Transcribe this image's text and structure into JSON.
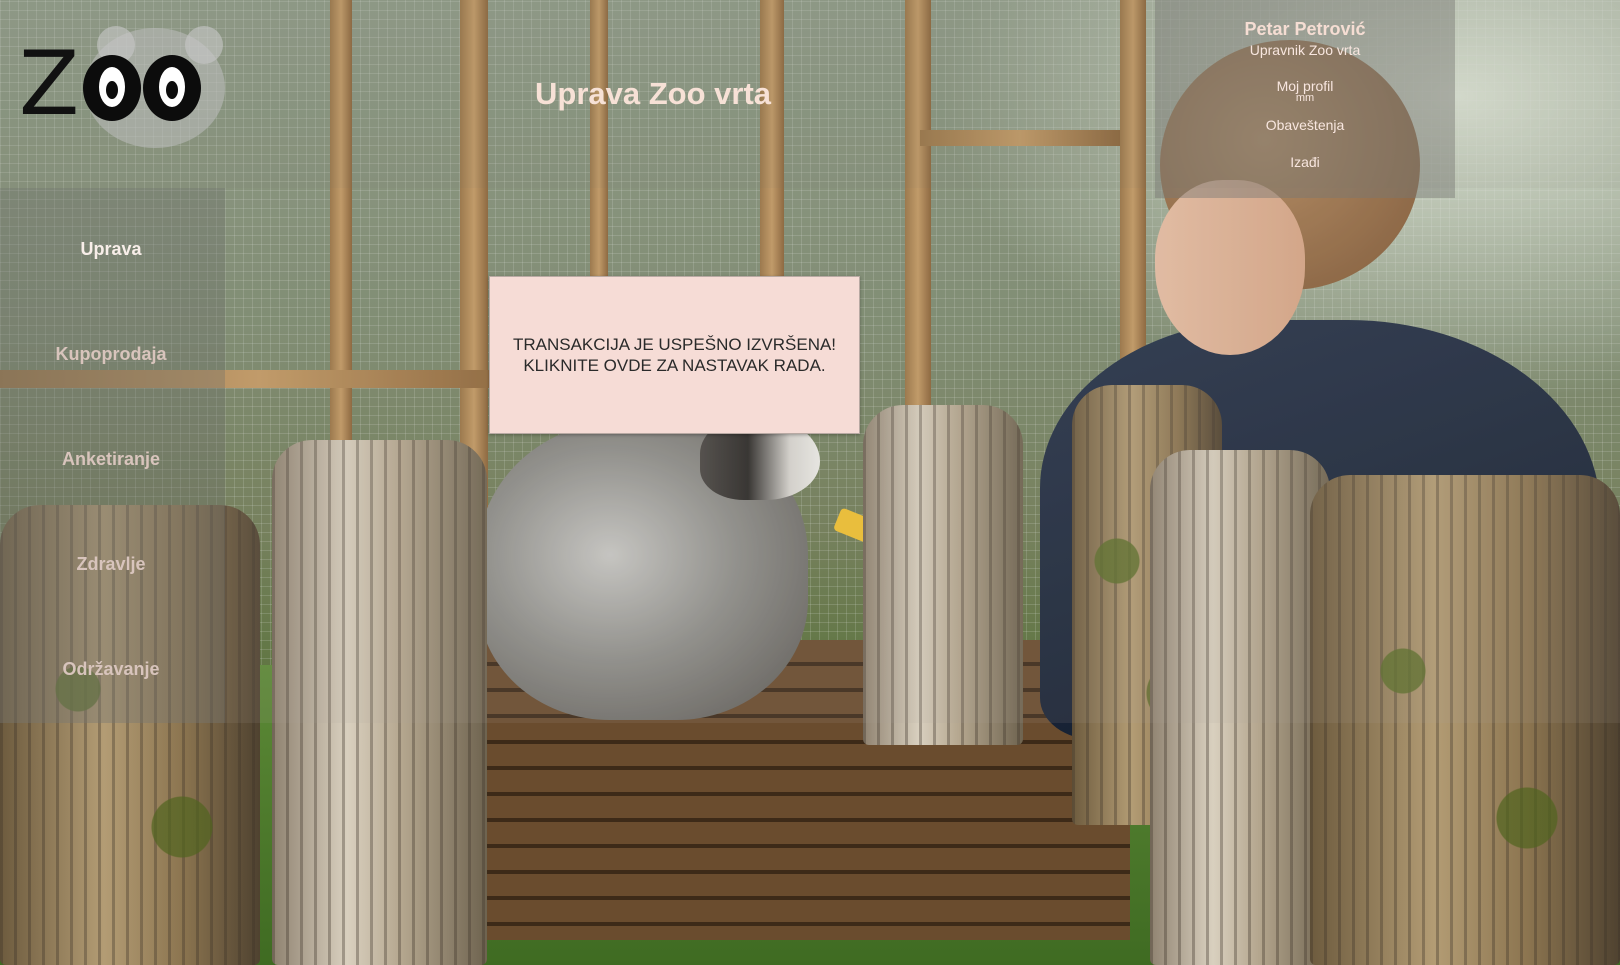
{
  "header": {
    "title": "Uprava Zoo vrta",
    "logo_text": "ZOO"
  },
  "user": {
    "name": "Petar Petrović",
    "role": "Upravnik Zoo vrta",
    "profile_label": "Moj profil",
    "profile_sub": "mm",
    "notifications_label": "Obaveštenja",
    "logout_label": "Izađi"
  },
  "sidebar": {
    "items": [
      {
        "label": "Uprava",
        "active": true
      },
      {
        "label": "Kupoprodaja",
        "active": false
      },
      {
        "label": "Anketiranje",
        "active": false
      },
      {
        "label": "Zdravlje",
        "active": false
      },
      {
        "label": "Održavanje",
        "active": false
      }
    ]
  },
  "modal": {
    "line1": "TRANSAKCIJA JE USPEŠNO IZVRŠENA!",
    "line2": "KLIKNITE OVDE ZA NASTAVAK RADA."
  },
  "colors": {
    "title_text": "#f7e1d6",
    "modal_bg": "#f6dcd6",
    "nav_text": "#d8c4bc",
    "nav_active_text": "#f8eee9"
  }
}
